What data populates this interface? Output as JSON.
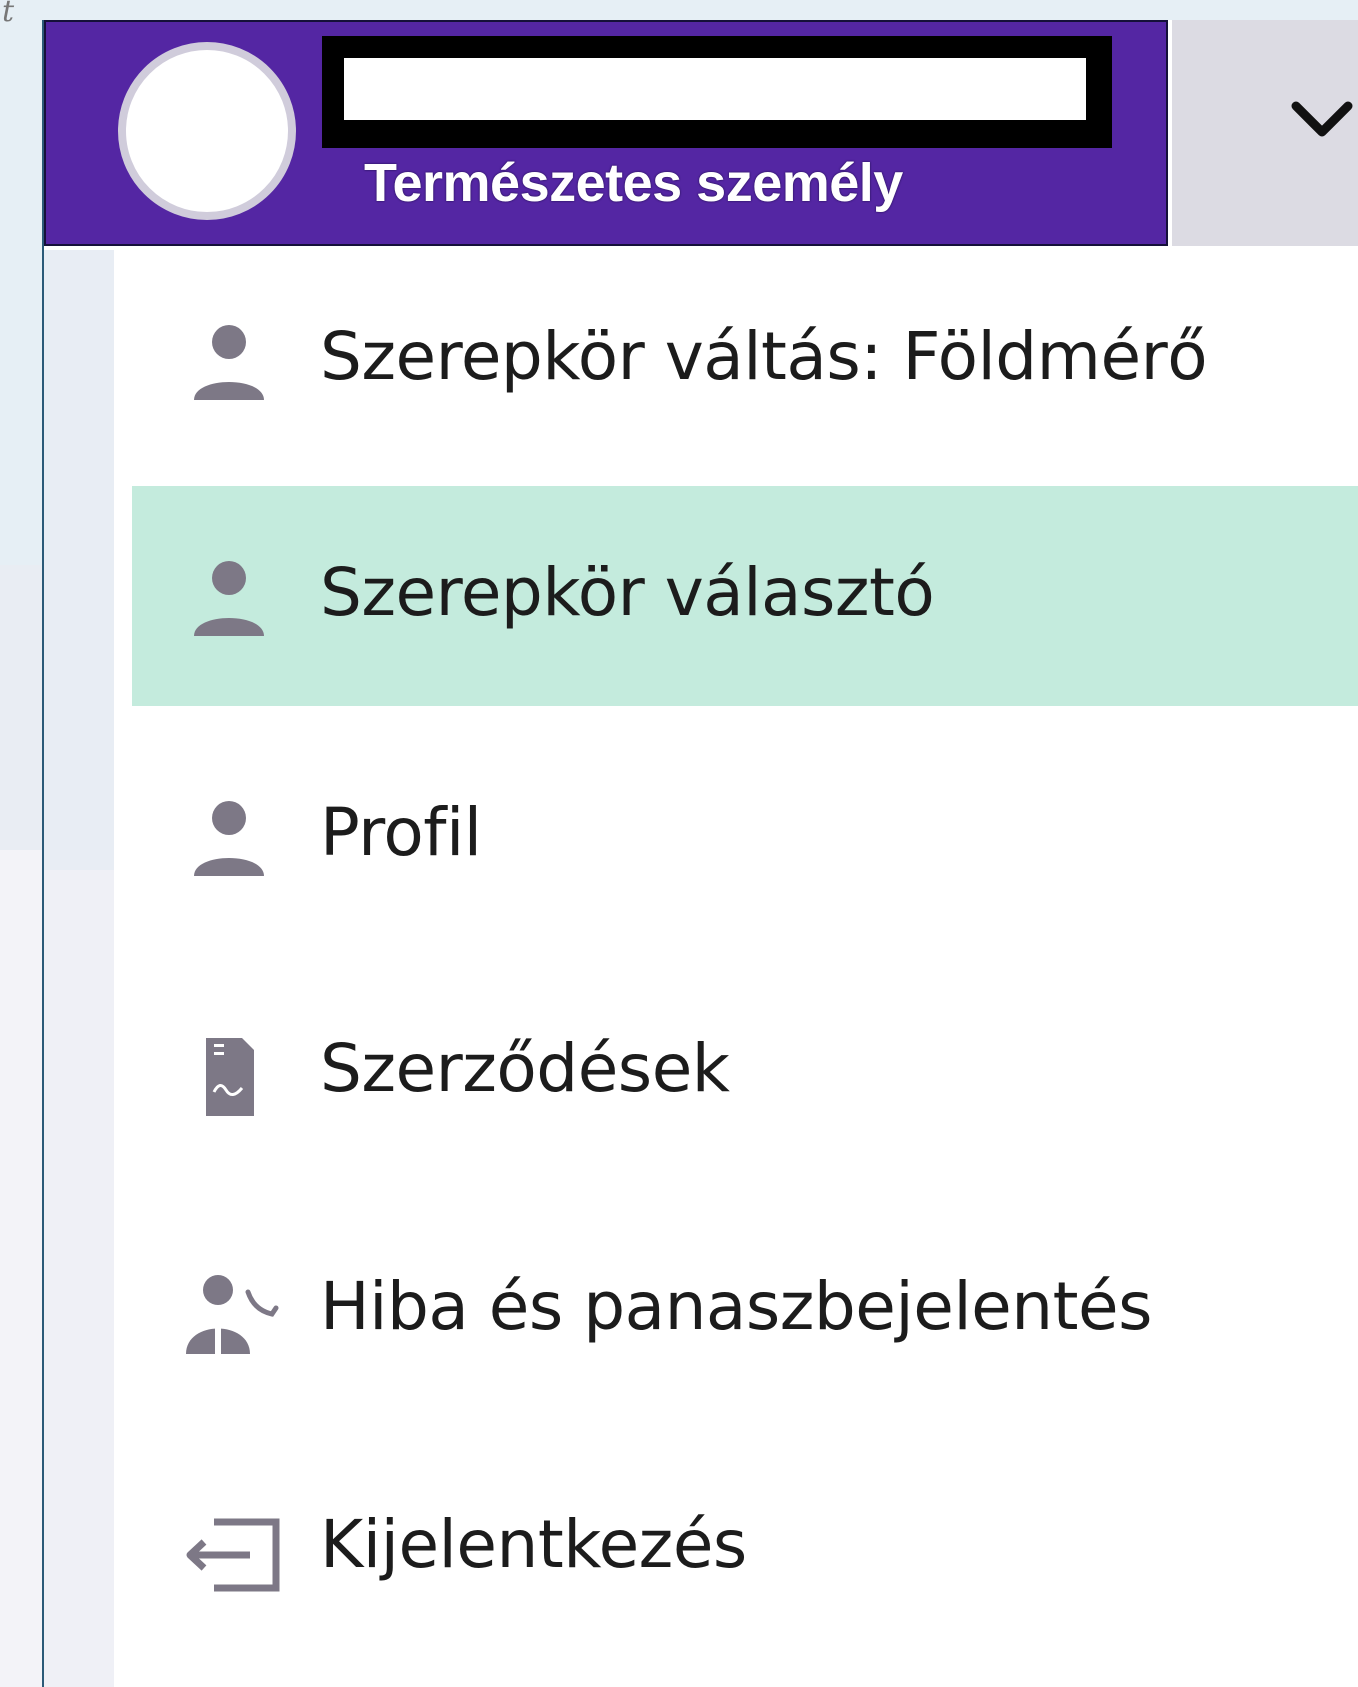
{
  "background": {
    "corner_glyph": "t"
  },
  "header": {
    "user_name": "",
    "user_type": "Természetes személy",
    "avatar_icon": "user-avatar",
    "toggle_icon": "chevron-down-icon",
    "colors": {
      "header_bg": "#5426a3",
      "toggle_bg": "#dcdbe3"
    }
  },
  "menu": {
    "active_color": "#c4ebdd",
    "icon_color": "#7d7886",
    "items": [
      {
        "label": "Szerepkör váltás: Földmérő",
        "icon": "person-icon",
        "active": false
      },
      {
        "label": "Szerepkör választó",
        "icon": "person-icon",
        "active": true
      },
      {
        "label": "Profil",
        "icon": "person-icon",
        "active": false
      },
      {
        "label": "Szerződések",
        "icon": "contract-document-icon",
        "active": false
      },
      {
        "label": "Hiba és panaszbejelentés",
        "icon": "support-call-icon",
        "active": false
      },
      {
        "label": "Kijelentkezés",
        "icon": "logout-icon",
        "active": false
      }
    ]
  }
}
